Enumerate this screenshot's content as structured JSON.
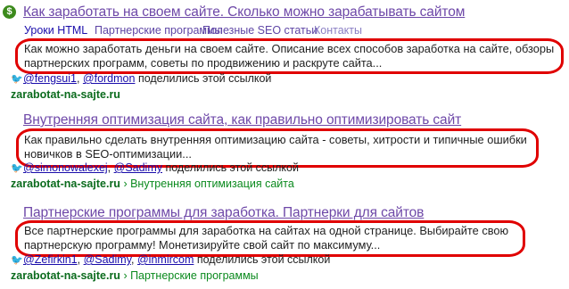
{
  "results": [
    {
      "title": "Как заработать на своем сайте. Сколько можно зарабатывать сайтом",
      "sitelinks": [
        "Уроки HTML",
        "Партнерские программы",
        "Полезные SEO статьи",
        "Контакты"
      ],
      "snippet_line1": "Как можно заработать деньги на своем сайте. Описание всех способов заработка на сайте, обзоры",
      "snippet_line2": "партнерских программ, советы по продвижению и раскруте сайта...",
      "social_users": [
        "@fengsui1",
        "@fordmon"
      ],
      "social_text": "поделились этой ссылкой",
      "domain": "zarabotat-na-sajte.ru",
      "breadcrumb": ""
    },
    {
      "title": "Внутренняя оптимизация сайта, как правильно оптимизировать сайт",
      "snippet_line1": "Как правильно сделать внутренняя оптимизацию сайта - советы, хитрости и типичные ошибки",
      "snippet_line2": "новичков в SEO-оптимизации...",
      "social_users": [
        "@simonowalexej",
        "@Sadimy"
      ],
      "social_text": "поделились этой ссылкой",
      "domain": "zarabotat-na-sajte.ru",
      "breadcrumb": "› Внутренняя оптимизация сайта"
    },
    {
      "title": "Партнерские программы для заработка. Партнерки для сайтов",
      "snippet_line1": "Все партнерские программы для заработка на сайтах на одной странице. Выбирайте свою",
      "snippet_line2": "партнерскую программу! Монетизируйте свой сайт по максимуму...",
      "social_users": [
        "@Zefirkin1",
        "@Sadimy",
        "@inmircom"
      ],
      "social_text": "поделились этой ссылкой",
      "domain": "zarabotat-na-sajte.ru",
      "breadcrumb": "› Партнерские программы"
    }
  ],
  "colors": {
    "title": "#6e48a8",
    "url_green": "#0b6b1d",
    "highlight_oval": "#e00000",
    "twitter": "#3a9fe0"
  },
  "icons": {
    "favicon": "dollar-favicon-icon",
    "social": "twitter-bird-icon"
  }
}
